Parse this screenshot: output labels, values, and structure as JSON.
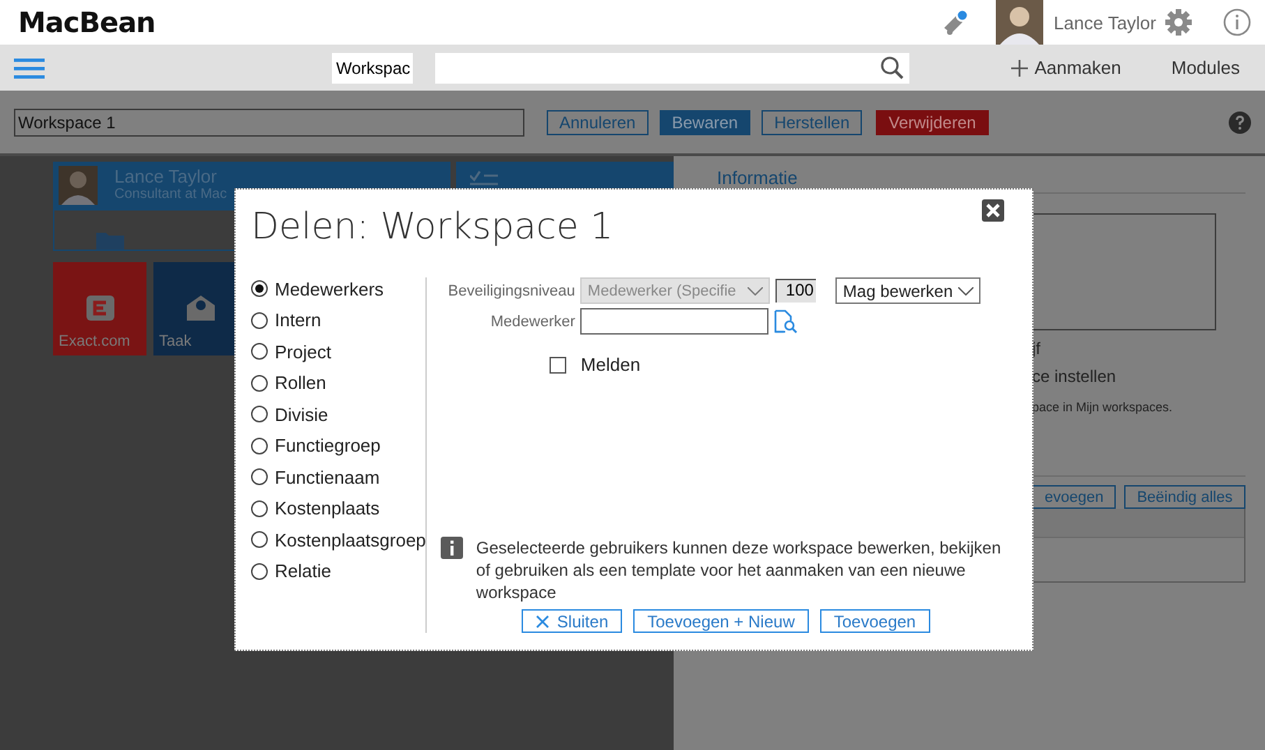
{
  "header": {
    "logo": "MacBean",
    "user_name": "Lance Taylor"
  },
  "toolbar": {
    "search_scope": "Workspac",
    "create": "Aanmaken",
    "modules": "Modules"
  },
  "action_bar": {
    "name_value": "Workspace 1",
    "buttons": [
      {
        "label": "Annuleren",
        "kind": "outline"
      },
      {
        "label": "Bewaren",
        "kind": "primary"
      },
      {
        "label": "Herstellen",
        "kind": "outline"
      },
      {
        "label": "Verwijderen",
        "kind": "danger"
      }
    ]
  },
  "background": {
    "profile": {
      "name": "Lance Taylor",
      "subtitle": "Consultant at Mac"
    },
    "tiles": [
      {
        "label": "Exact.com",
        "kind": "exact"
      },
      {
        "label": "Taak",
        "kind": "task"
      }
    ],
    "info": {
      "title": "Informatie",
      "fragments": [
        "jf",
        "ce instellen",
        "pace in Mijn workspaces."
      ],
      "buttons": [
        "evoegen",
        "Beëindig alles"
      ]
    }
  },
  "dialog": {
    "title": "Delen: Workspace 1",
    "options": [
      {
        "label": "Medewerkers",
        "selected": true
      },
      {
        "label": "Intern",
        "selected": false
      },
      {
        "label": "Project",
        "selected": false
      },
      {
        "label": "Rollen",
        "selected": false
      },
      {
        "label": "Divisie",
        "selected": false
      },
      {
        "label": "Functiegroep",
        "selected": false
      },
      {
        "label": "Functienaam",
        "selected": false
      },
      {
        "label": "Kostenplaats",
        "selected": false
      },
      {
        "label": "Kostenplaatsgroep",
        "selected": false
      },
      {
        "label": "Relatie",
        "selected": false
      }
    ],
    "security_label": "Beveiligingsniveau",
    "security_value": "Medewerker (Specifie",
    "security_disabled": true,
    "level_number": "100",
    "permission": "Mag bewerken",
    "employee_label": "Medewerker",
    "notify": {
      "label": "Melden",
      "checked": false
    },
    "info_text": "Geselecteerde gebruikers kunnen deze workspace bewerken, bekijken of gebruiken als een template voor het aanmaken van een nieuwe workspace",
    "buttons": [
      {
        "label": "Sluiten",
        "kind": "close"
      },
      {
        "label": "Toevoegen + Nieuw",
        "kind": "plain"
      },
      {
        "label": "Toevoegen",
        "kind": "plain"
      }
    ]
  }
}
